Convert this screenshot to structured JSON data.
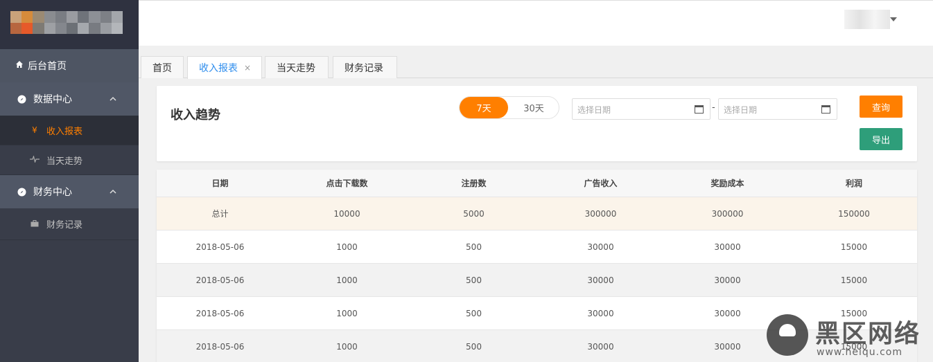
{
  "sidebar": {
    "home_label": "后台首页",
    "groups": [
      {
        "label": "数据中心",
        "items": [
          {
            "label": "收入报表",
            "icon": "yen-icon",
            "active": true
          },
          {
            "label": "当天走势",
            "icon": "pulse-icon",
            "active": false
          }
        ]
      },
      {
        "label": "财务中心",
        "items": [
          {
            "label": "财务记录",
            "icon": "briefcase-icon",
            "active": false
          }
        ]
      }
    ]
  },
  "tabs": [
    {
      "label": "首页"
    },
    {
      "label": "收入报表",
      "close": "×"
    },
    {
      "label": "当天走势"
    },
    {
      "label": "财务记录"
    }
  ],
  "card": {
    "title": "收入趋势",
    "range_7": "7天",
    "range_30": "30天",
    "date_start_placeholder": "选择日期",
    "date_end_placeholder": "选择日期",
    "dash": "-",
    "query_label": "查询",
    "export_label": "导出"
  },
  "table": {
    "headers": [
      "日期",
      "点击下载数",
      "注册数",
      "广告收入",
      "奖励成本",
      "利润"
    ],
    "rows": [
      [
        "总计",
        "10000",
        "5000",
        "300000",
        "300000",
        "150000"
      ],
      [
        "2018-05-06",
        "1000",
        "500",
        "30000",
        "30000",
        "15000"
      ],
      [
        "2018-05-06",
        "1000",
        "500",
        "30000",
        "30000",
        "15000"
      ],
      [
        "2018-05-06",
        "1000",
        "500",
        "30000",
        "30000",
        "15000"
      ],
      [
        "2018-05-06",
        "1000",
        "500",
        "30000",
        "30000",
        "15000"
      ]
    ]
  },
  "watermark": {
    "text": "黑区网络",
    "url": "www.heiqu.com"
  },
  "colors": {
    "accent": "#ff7f00",
    "export": "#2e9e7a",
    "tab_active": "#2e8ded",
    "sidebar": "#393d49"
  }
}
